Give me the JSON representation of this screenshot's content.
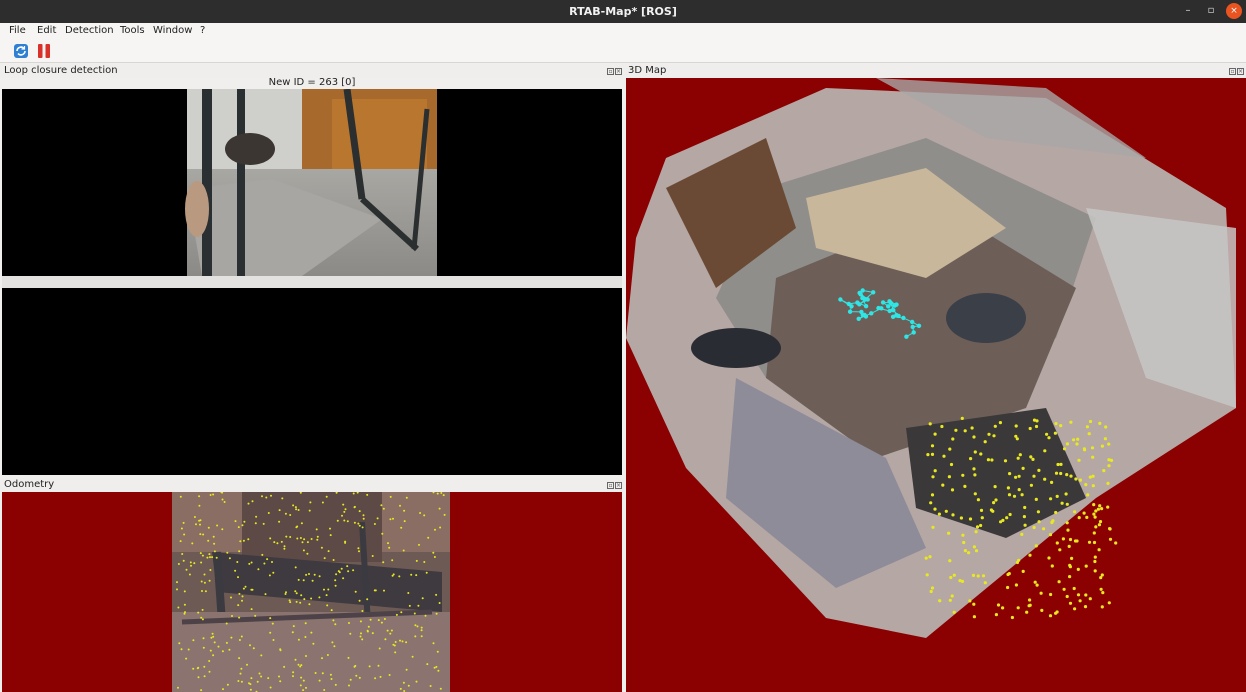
{
  "window": {
    "title": "RTAB-Map* [ROS]",
    "btn_minimize": "–",
    "btn_maximize": "▫",
    "btn_close": "×"
  },
  "menu": {
    "items": [
      "File",
      "Edit",
      "Detection",
      "Tools",
      "Window",
      "?"
    ]
  },
  "toolbar": {
    "refresh_icon": "refresh-icon",
    "pause_icon": "pause-icon"
  },
  "loop_closure": {
    "title": "Loop closure detection",
    "status": "New ID = 263 [0]"
  },
  "odometry": {
    "title": "Odometry"
  },
  "map3d": {
    "title": "3D Map"
  },
  "colors": {
    "background_red": "#8b0000",
    "trajectory_cyan": "#2ee6e6",
    "features_yellow": "#e8e820",
    "accent_orange": "#e95420"
  }
}
